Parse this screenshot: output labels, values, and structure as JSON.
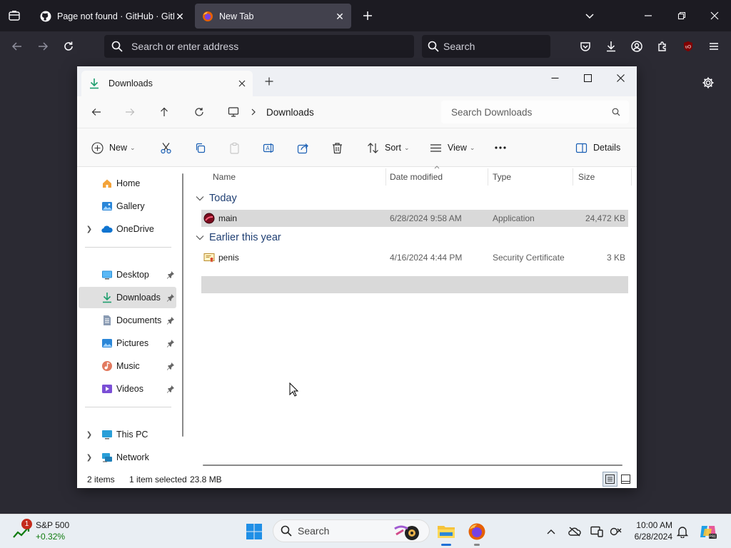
{
  "browser": {
    "tabs": [
      {
        "title": "Page not found · GitHub · GitHub",
        "active": false
      },
      {
        "title": "New Tab",
        "active": true
      }
    ],
    "urlbar_placeholder": "Search or enter address",
    "searchbar_placeholder": "Search"
  },
  "explorer": {
    "tab_title": "Downloads",
    "breadcrumb": [
      "Downloads"
    ],
    "search_placeholder": "Search Downloads",
    "toolbar": {
      "new_label": "New",
      "sort_label": "Sort",
      "view_label": "View",
      "details_label": "Details"
    },
    "nav": {
      "top_items": [
        {
          "label": "Home",
          "icon": "home-icon"
        },
        {
          "label": "Gallery",
          "icon": "gallery-icon"
        },
        {
          "label": "OneDrive",
          "icon": "onedrive-icon",
          "expandable": true
        }
      ],
      "quick_access": [
        {
          "label": "Desktop",
          "icon": "desktop-icon",
          "pinned": true
        },
        {
          "label": "Downloads",
          "icon": "downloads-icon",
          "pinned": true,
          "selected": true
        },
        {
          "label": "Documents",
          "icon": "documents-icon",
          "pinned": true
        },
        {
          "label": "Pictures",
          "icon": "pictures-icon",
          "pinned": true
        },
        {
          "label": "Music",
          "icon": "music-icon",
          "pinned": true
        },
        {
          "label": "Videos",
          "icon": "videos-icon",
          "pinned": true
        }
      ],
      "bottom_items": [
        {
          "label": "This PC",
          "icon": "this-pc-icon",
          "expandable": true
        },
        {
          "label": "Network",
          "icon": "network-icon",
          "expandable": true
        }
      ]
    },
    "columns": [
      "Name",
      "Date modified",
      "Type",
      "Size"
    ],
    "groups": [
      {
        "label": "Today",
        "files": [
          {
            "name": "main",
            "date": "6/28/2024 9:58 AM",
            "type": "Application",
            "size": "24,472 KB",
            "selected": true
          }
        ]
      },
      {
        "label": "Earlier this year",
        "files": [
          {
            "name": "penis",
            "date": "4/16/2024 4:44 PM",
            "type": "Security Certificate",
            "size": "3 KB",
            "selected": false
          }
        ]
      }
    ],
    "status": {
      "count": "2 items",
      "selection": "1 item selected",
      "selection_size": "23.8 MB"
    }
  },
  "taskbar": {
    "widget": {
      "badge": "1",
      "name": "S&P 500",
      "change": "+0.32%"
    },
    "search_placeholder": "Search",
    "clock": {
      "time": "10:00 AM",
      "date": "6/28/2024"
    }
  }
}
